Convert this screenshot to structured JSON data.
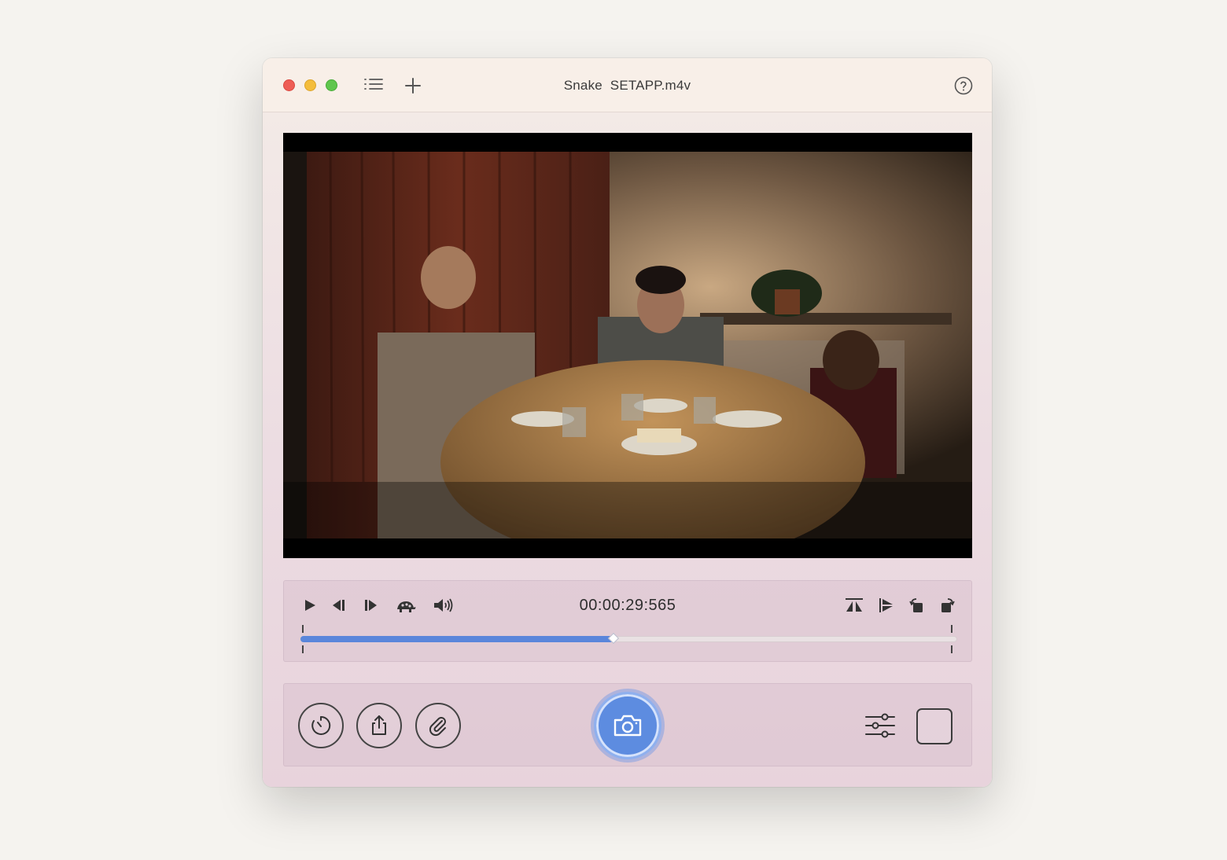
{
  "window": {
    "title": "Snake  SETAPP.m4v"
  },
  "titlebar": {
    "icons": [
      "close-traffic-light",
      "minimize-traffic-light",
      "zoom-traffic-light",
      "list-icon",
      "plus-icon",
      "help-icon"
    ]
  },
  "player": {
    "timecode": "00:00:29:565",
    "progress": 0.477,
    "left_controls": [
      "play-icon",
      "step-back-icon",
      "step-forward-icon",
      "turtle-icon",
      "volume-icon"
    ],
    "right_controls": [
      "flip-horizontal-icon",
      "flip-vertical-icon",
      "rotate-left-icon",
      "rotate-right-icon"
    ]
  },
  "bottombar": {
    "left_buttons": [
      "timer-icon",
      "share-icon",
      "paperclip-icon"
    ],
    "center_button": "camera-icon",
    "right_buttons": [
      "sliders-icon",
      "square-icon"
    ]
  },
  "colors": {
    "accent": "#5a86db",
    "close": "#ee5d55",
    "minimize": "#f4bd3c",
    "zoom": "#5fc64d"
  }
}
